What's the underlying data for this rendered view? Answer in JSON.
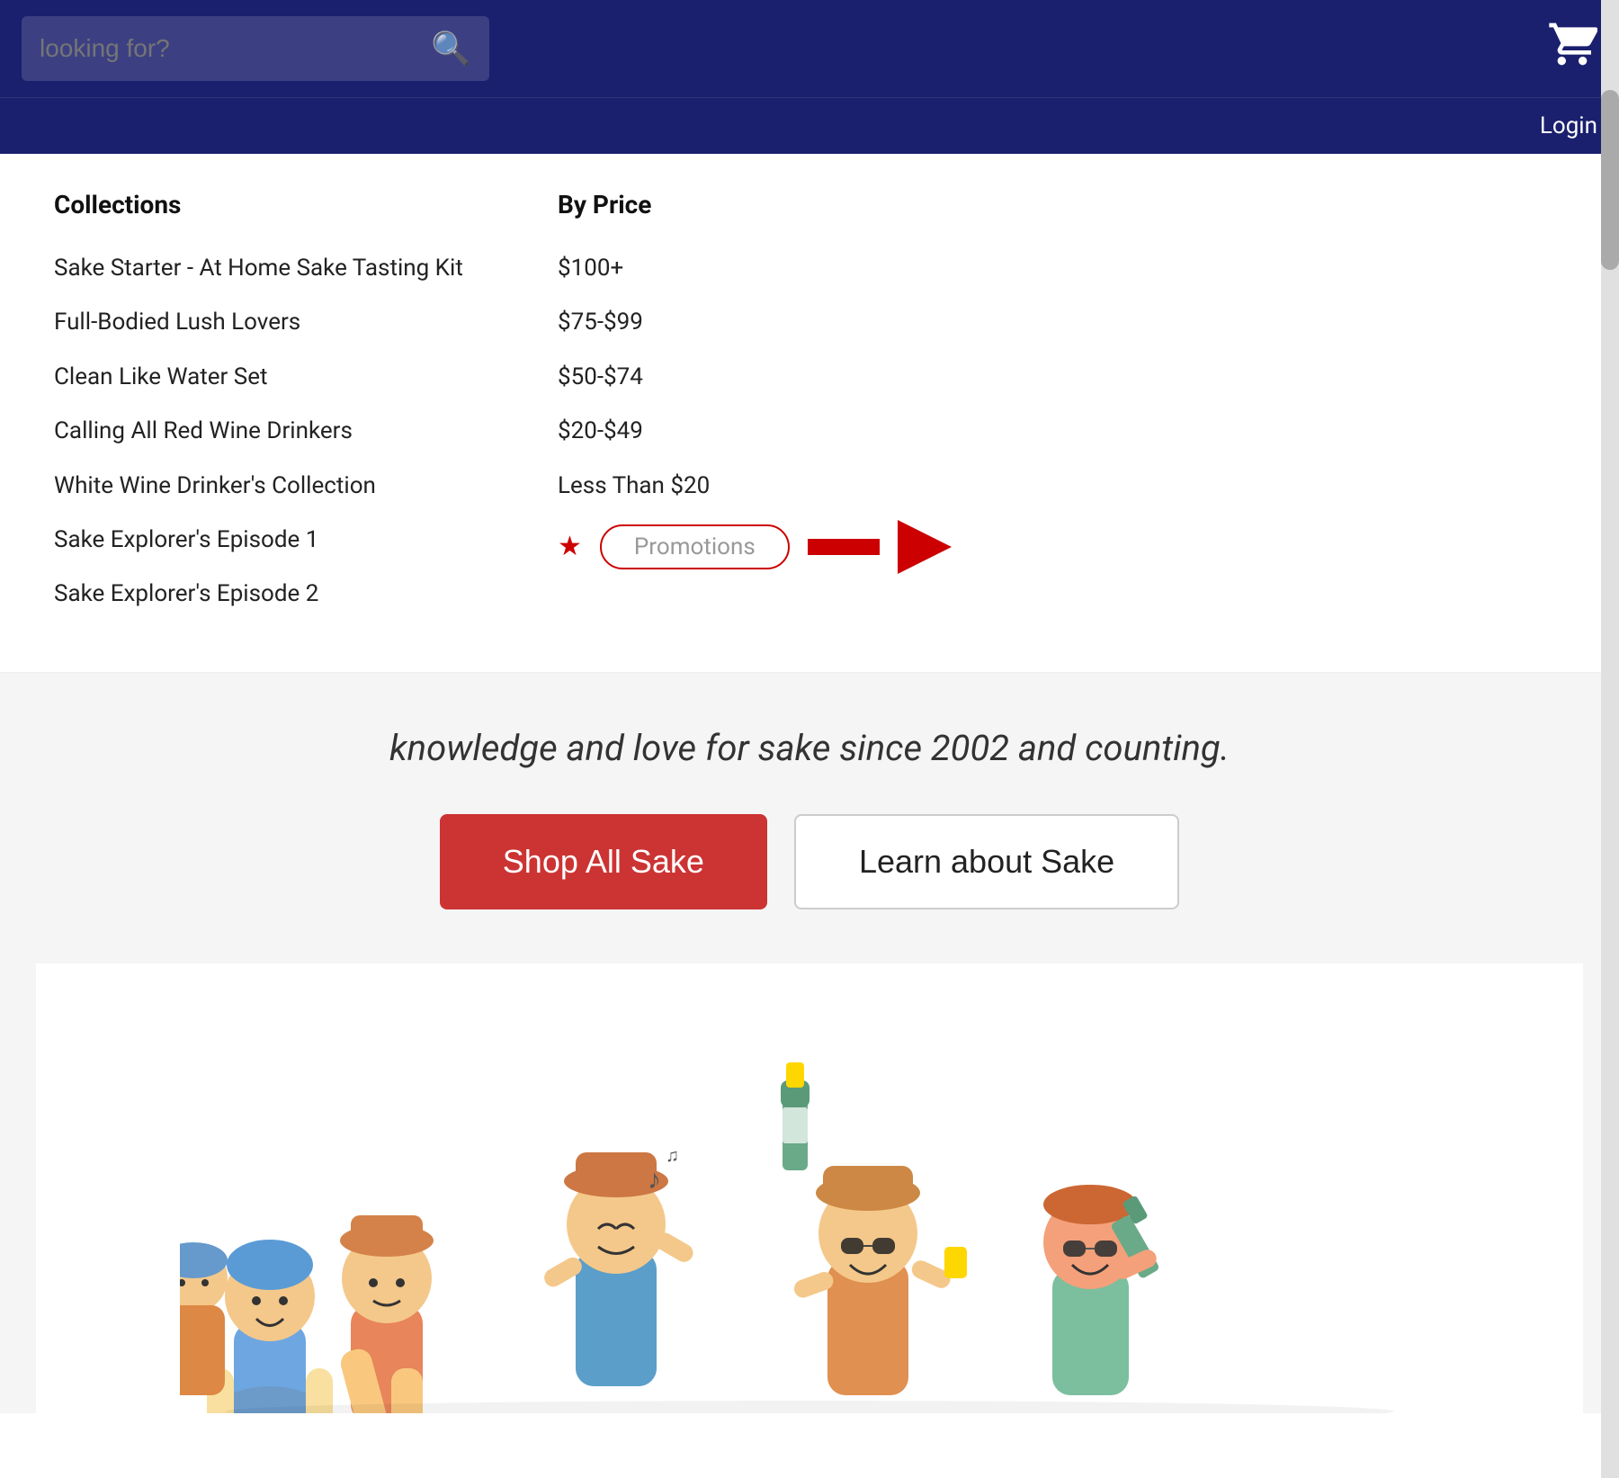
{
  "header": {
    "search_placeholder": "looking for?",
    "login_label": "Login",
    "cart_icon": "cart-icon",
    "search_icon": "search-icon"
  },
  "menu": {
    "collections_header": "Collections",
    "by_price_header": "By Price",
    "collections": [
      "Sake Starter - At Home Sake Tasting Kit",
      "Full-Bodied Lush Lovers",
      "Clean Like Water Set",
      "Calling All Red Wine Drinkers",
      "White Wine Drinker's Collection",
      "Sake Explorer's Episode 1",
      "Sake Explorer's Episode 2"
    ],
    "prices": [
      "$100+",
      "$75-$99",
      "$50-$74",
      "$20-$49",
      "Less Than $20"
    ],
    "promotions_label": "Promotions"
  },
  "hero": {
    "tagline": "knowledge and love for sake since 2002 and counting.",
    "shop_button": "Shop All Sake",
    "learn_button": "Learn about Sake"
  },
  "colors": {
    "navy": "#1a1f6e",
    "red": "#cc3333",
    "annotation_red": "#cc0000"
  }
}
